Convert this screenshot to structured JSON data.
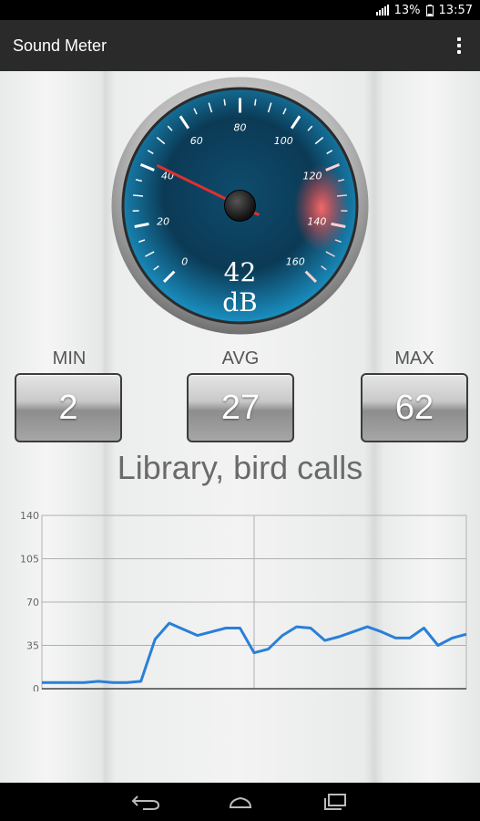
{
  "status_bar": {
    "battery": "13%",
    "time": "13:57",
    "icons": [
      "signal-icon",
      "battery-icon"
    ]
  },
  "action_bar": {
    "title": "Sound Meter",
    "menu_icon": "overflow-menu-icon"
  },
  "gauge": {
    "value": 42,
    "value_text": "42",
    "unit": "dB",
    "scale_min": 0,
    "scale_max": 160,
    "scale_labels": [
      "0",
      "20",
      "40",
      "60",
      "80",
      "100",
      "120",
      "140",
      "160"
    ],
    "colors": {
      "face": "#0d5b84",
      "needle": "#e03030",
      "danger": "#ff4a4a"
    }
  },
  "stats": [
    {
      "label": "MIN",
      "value": "2"
    },
    {
      "label": "AVG",
      "value": "27"
    },
    {
      "label": "MAX",
      "value": "62"
    }
  ],
  "place": "Library, bird calls",
  "chart_data": {
    "type": "line",
    "title": "",
    "xlabel": "",
    "ylabel": "",
    "ylim": [
      0,
      140
    ],
    "yticks": [
      "0",
      "35",
      "70",
      "105",
      "140"
    ],
    "grid": true,
    "series": [
      {
        "values": [
          5,
          5,
          5,
          5,
          6,
          5,
          5,
          6,
          40,
          53,
          48,
          43,
          46,
          49,
          49,
          29,
          32,
          43,
          50,
          49,
          39,
          42,
          46,
          50,
          46,
          41,
          41,
          49,
          35,
          41,
          44
        ],
        "color": "#2a7fd8"
      }
    ]
  },
  "nav_bar": {
    "buttons": [
      "back-icon",
      "home-icon",
      "recents-icon"
    ]
  }
}
